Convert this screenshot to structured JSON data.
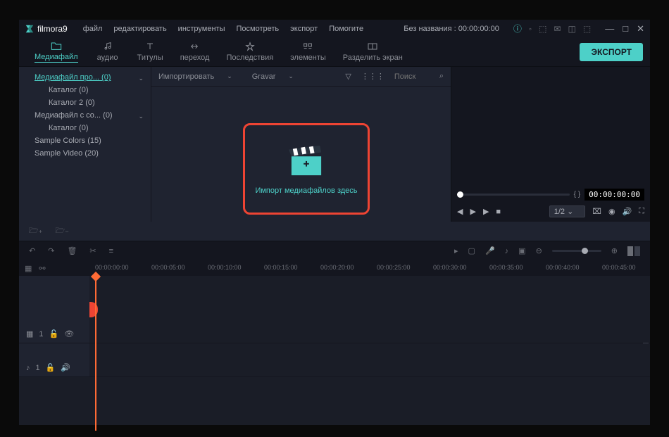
{
  "titlebar": {
    "logo": "filmora9",
    "menu": [
      "файл",
      "редактировать",
      "инструменты",
      "Посмотреть",
      "экспорт",
      "Помогите"
    ],
    "project": "Без названия : 00:00:00:00"
  },
  "tooltabs": [
    {
      "icon": "folder",
      "label": "Медиафайл",
      "active": true
    },
    {
      "icon": "music",
      "label": "аудио"
    },
    {
      "icon": "text",
      "label": "Титулы"
    },
    {
      "icon": "transition",
      "label": "переход"
    },
    {
      "icon": "effects",
      "label": "Последствия"
    },
    {
      "icon": "elements",
      "label": "элементы"
    },
    {
      "icon": "split",
      "label": "Разделить экран"
    }
  ],
  "export_btn": "ЭКСПОРТ",
  "sidebar": [
    {
      "label": "Медиафайл про... (0)",
      "lvl": 1,
      "active": true,
      "chev": true
    },
    {
      "label": "Каталог (0)",
      "lvl": 2
    },
    {
      "label": "Каталог 2 (0)",
      "lvl": 2
    },
    {
      "label": "Медиафайл с со... (0)",
      "lvl": 1,
      "chev": true
    },
    {
      "label": "Каталог (0)",
      "lvl": 2
    },
    {
      "label": "Sample Colors (15)",
      "lvl": 1
    },
    {
      "label": "Sample Video (20)",
      "lvl": 1
    }
  ],
  "media_toolbar": {
    "import": "Импортировать",
    "record": "Gravar",
    "search_placeholder": "Поиск"
  },
  "drop_text": "Импорт медиафайлов здесь",
  "preview": {
    "brackets": "{   }",
    "timecode": "00:00:00:00",
    "zoom": "1/2"
  },
  "ruler": [
    "00:00:00:00",
    "00:00:05:00",
    "00:00:10:00",
    "00:00:15:00",
    "00:00:20:00",
    "00:00:25:00",
    "00:00:30:00",
    "00:00:35:00",
    "00:00:40:00",
    "00:00:45:00"
  ],
  "tracks": {
    "video_label": "1",
    "audio_label": "1"
  }
}
